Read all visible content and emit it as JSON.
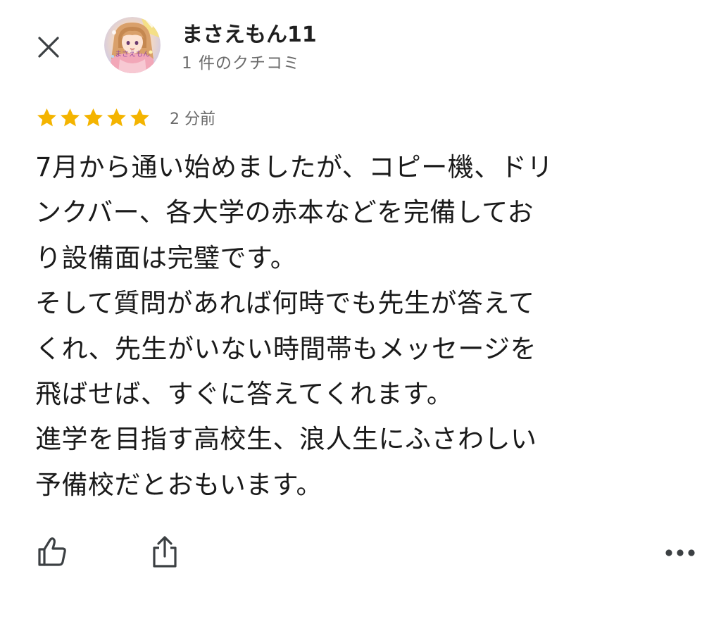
{
  "header": {
    "user_name": "まさえもん11",
    "review_count": "1 件のクチコミ",
    "avatar_text": "まさえもん"
  },
  "review": {
    "rating": 5,
    "max_rating": 5,
    "time_ago": "2 分前",
    "lines": [
      "7月から通い始めましたが、コピー機、ドリ",
      "ンクバー、各大学の赤本などを完備してお",
      "り設備面は完璧です。",
      "そして質問があれば何時でも先生が答えて",
      "くれ、先生がいない時間帯もメッセージを",
      "飛ばせば、すぐに答えてくれます。",
      "進学を目指す高校生、浪人生にふさわしい",
      "予備校だとおもいます。"
    ]
  },
  "icons": {
    "close": "close-icon",
    "like": "thumbs-up-icon",
    "share": "share-icon",
    "more": "more-horizontal-icon",
    "star": "star-icon"
  },
  "colors": {
    "star": "#F4B400",
    "text": "#1f1f1f",
    "secondary_text": "#6b6b6b",
    "icon": "#3c4043"
  }
}
